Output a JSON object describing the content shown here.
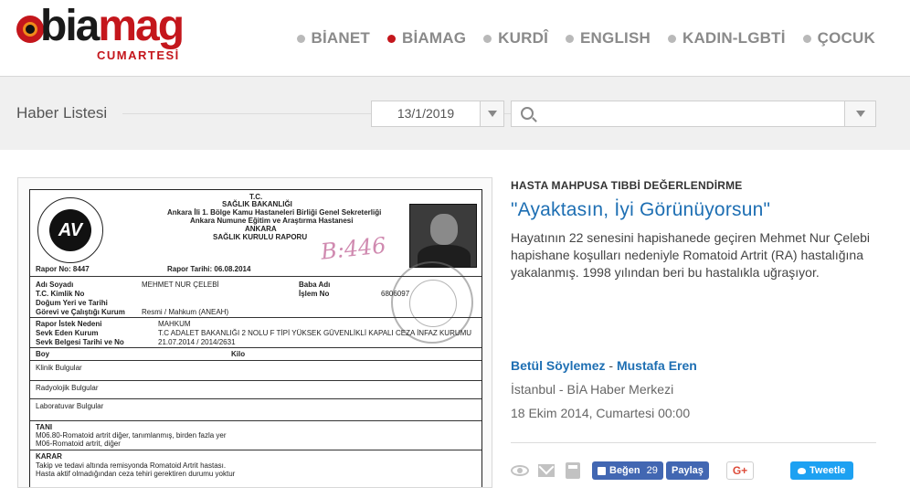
{
  "logo": {
    "part1": "bia",
    "part2": "mag",
    "subtitle": "CUMARTESİ"
  },
  "nav": [
    {
      "label": "BİANET",
      "active": false
    },
    {
      "label": "BİAMAG",
      "active": true
    },
    {
      "label": "KURDÎ",
      "active": false
    },
    {
      "label": "ENGLISH",
      "active": false
    },
    {
      "label": "KADIN-LGBTİ",
      "active": false
    },
    {
      "label": "ÇOCUK",
      "active": false
    }
  ],
  "filter": {
    "title": "Haber Listesi",
    "date_value": "13/1/2019",
    "search_placeholder": ""
  },
  "article": {
    "kicker": "HASTA MAHPUSA TIBBİ DEĞERLENDİRME",
    "title": "\"Ayaktasın, İyi Görünüyorsun\"",
    "summary": "Hayatının 22 senesini hapishanede geçiren Mehmet Nur Çelebi hapishane koşulları nedeniyle Romatoid Artrit (RA) hastalığına yakalanmış. 1998 yılından beri bu hastalıkla uğraşıyor.",
    "author1": "Betül Söylemez",
    "author_sep": " - ",
    "author2": "Mustafa Eren",
    "source": "İstanbul - BİA Haber Merkezi",
    "date": "18 Ekim 2014, Cumartesi 00:00"
  },
  "document": {
    "header": [
      "T.C.",
      "SAĞLIK BAKANLIĞI",
      "Ankara İli 1. Bölge Kamu Hastaneleri Birliği Genel Sekreterliği",
      "Ankara Numune Eğitim ve Araştırma Hastanesi",
      "ANKARA",
      "SAĞLIK KURULU RAPORU"
    ],
    "emblem": "AV",
    "report_no": "Rapor No: 8447",
    "report_date": "Rapor Tarihi: 06.08.2014",
    "scribble": "B:446",
    "rows": [
      {
        "label": "Adı Soyadı",
        "value": "MEHMET NUR ÇELEBİ"
      },
      {
        "label": "T.C. Kimlik No",
        "value": ""
      },
      {
        "label": "Doğum Yeri ve Tarihi",
        "value": ""
      },
      {
        "label": "Görevi ve Çalıştığı Kurum",
        "value": "Resmi / Mahkum (ANEAH)"
      },
      {
        "label": "Rapor İstek Nedeni",
        "value": "MAHKUM"
      },
      {
        "label": "Sevk Eden Kurum",
        "value": "T.C ADALET BAKANLIĞI 2 NOLU F TİPİ YÜKSEK GÜVENLİKLİ KAPALI CEZA İNFAZ KURUMU"
      },
      {
        "label": "Sevk Belgesi Tarihi ve No",
        "value": "21.07.2014 / 2014/2631"
      }
    ],
    "father_label": "Baba Adı",
    "protocol_label": "İşlem No",
    "protocol_value": "6806097",
    "boy_label": "Boy",
    "kilo_label": "Kilo",
    "sections": [
      "Klinik Bulgular",
      "Radyolojik Bulgular",
      "Laboratuvar Bulgular"
    ],
    "tani_label": "TANI",
    "tani_lines": [
      "M06.80-Romatoid artrit diğer, tanımlanmış, birden fazla yer",
      "M06-Romatoid artrit, diğer"
    ],
    "karar_label": "KARAR",
    "karar_lines": [
      "Takip ve tedavi altında remisyonda Romatoid Artrit hastası.",
      "Hasta aktif olmadığından ceza tehiri gerektiren durumu yoktur"
    ]
  },
  "actions": {
    "like_label": "Beğen",
    "like_count": "29",
    "share_label": "Paylaş",
    "gplus_label": "G+",
    "tweet_label": "Tweetle"
  }
}
